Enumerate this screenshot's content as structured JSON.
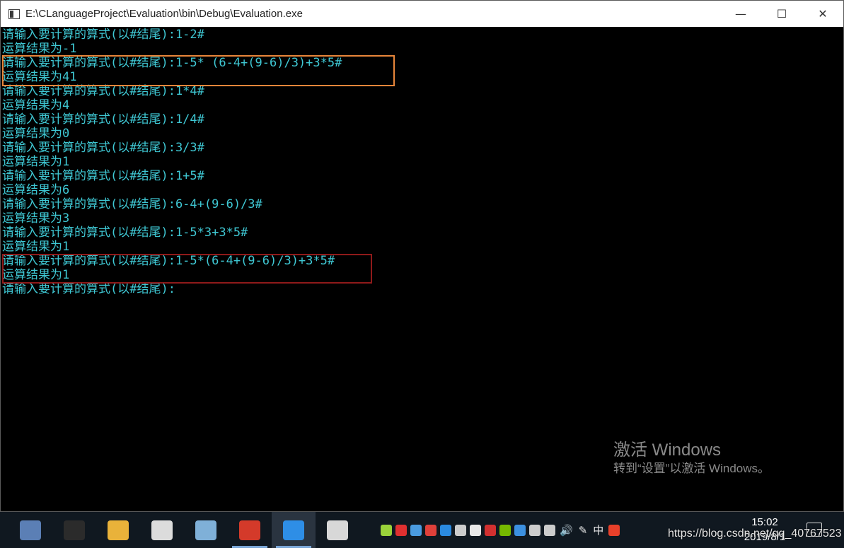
{
  "window": {
    "title": "E:\\CLanguageProject\\Evaluation\\bin\\Debug\\Evaluation.exe",
    "minimize_glyph": "—",
    "maximize_glyph": "☐",
    "close_glyph": "✕"
  },
  "console": {
    "text_color": "#3fc8d4",
    "lines": [
      "请输入要计算的算式(以#结尾):1-2#",
      "运算结果为-1",
      "请输入要计算的算式(以#结尾):1-5* (6-4+(9-6)/3)+3*5#",
      "运算结果为41",
      "请输入要计算的算式(以#结尾):1*4#",
      "运算结果为4",
      "请输入要计算的算式(以#结尾):1/4#",
      "运算结果为0",
      "请输入要计算的算式(以#结尾):3/3#",
      "运算结果为1",
      "请输入要计算的算式(以#结尾):1+5#",
      "运算结果为6",
      "请输入要计算的算式(以#结尾):6-4+(9-6)/3#",
      "运算结果为3",
      "请输入要计算的算式(以#结尾):1-5*3+3*5#",
      "运算结果为1",
      "请输入要计算的算式(以#结尾):1-5*(6-4+(9-6)/3)+3*5#",
      "运算结果为1",
      "请输入要计算的算式(以#结尾):"
    ]
  },
  "highlights": {
    "orange_color": "#e8863a",
    "red_color": "#8f1a1a"
  },
  "activation": {
    "line1": "激活 Windows",
    "line2": "转到“设置”以激活 Windows。"
  },
  "taskbar": {
    "apps": [
      {
        "name": "network-computer-icon",
        "color": "#5b7fb5"
      },
      {
        "name": "console-icon",
        "color": "#2b2b2b"
      },
      {
        "name": "file-explorer-icon",
        "color": "#e9b23a"
      },
      {
        "name": "steam-like-icon",
        "color": "#dcdcdc"
      },
      {
        "name": "notepad-icon",
        "color": "#7fb0d8"
      },
      {
        "name": "visual-studio-blocks-icon",
        "color": "#d43a2a"
      },
      {
        "name": "pinned-app-icon",
        "color": "#2e8ee6"
      },
      {
        "name": "evaluation-exe-icon",
        "color": "#d8d8d8"
      }
    ],
    "tray_icons": [
      {
        "name": "green-circle-icon",
        "color": "#9ad23a"
      },
      {
        "name": "record-icon",
        "color": "#e03030"
      },
      {
        "name": "box-icon",
        "color": "#4a9be0"
      },
      {
        "name": "red-app-icon",
        "color": "#e0403a"
      },
      {
        "name": "blue-star-icon",
        "color": "#2a8ae0"
      },
      {
        "name": "copy-icon",
        "color": "#cccccc"
      },
      {
        "name": "shield-icon",
        "color": "#e8e8e8"
      },
      {
        "name": "blocked-icon",
        "color": "#d23030"
      },
      {
        "name": "nvidia-icon",
        "color": "#76b900"
      },
      {
        "name": "bluetooth-icon",
        "color": "#3c90e0"
      },
      {
        "name": "printer-icon",
        "color": "#cccccc"
      },
      {
        "name": "network-warning-icon",
        "color": "#cccccc"
      }
    ],
    "volume_glyph": "🔊",
    "pen_glyph": "✎",
    "ime_glyph": "中",
    "sogou_color": "#e8402a",
    "clock_time": "15:02",
    "clock_date": "2019/8/1"
  },
  "watermark": "https://blog.csdn.net/qq_40767523"
}
